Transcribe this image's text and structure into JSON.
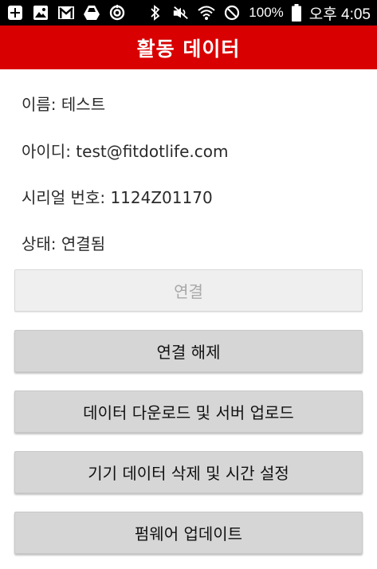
{
  "status_bar": {
    "battery": "100%",
    "time": "오후 4:05",
    "left_icons": [
      "plus-box-icon",
      "image-icon",
      "gmail-icon",
      "drive-icon",
      "sync-icon"
    ],
    "right_icons": [
      "bluetooth-icon",
      "mute-icon",
      "wifi-icon",
      "blocked-icon",
      "battery-icon"
    ]
  },
  "app_bar": {
    "title": "활동 데이터",
    "background": "#d80000"
  },
  "info": {
    "name": "이름: 테스트",
    "id": "아이디: test@fitdotlife.com",
    "serial": "시리얼 번호: 1124Z01170",
    "state": "상태: 연결됨"
  },
  "buttons": {
    "connect": "연결",
    "disconnect": "연결 해제",
    "download_upload": "데이터 다운로드 및 서버 업로드",
    "delete_time": "기기 데이터 삭제 및 시간 설정",
    "firmware": "펌웨어 업데이트"
  }
}
